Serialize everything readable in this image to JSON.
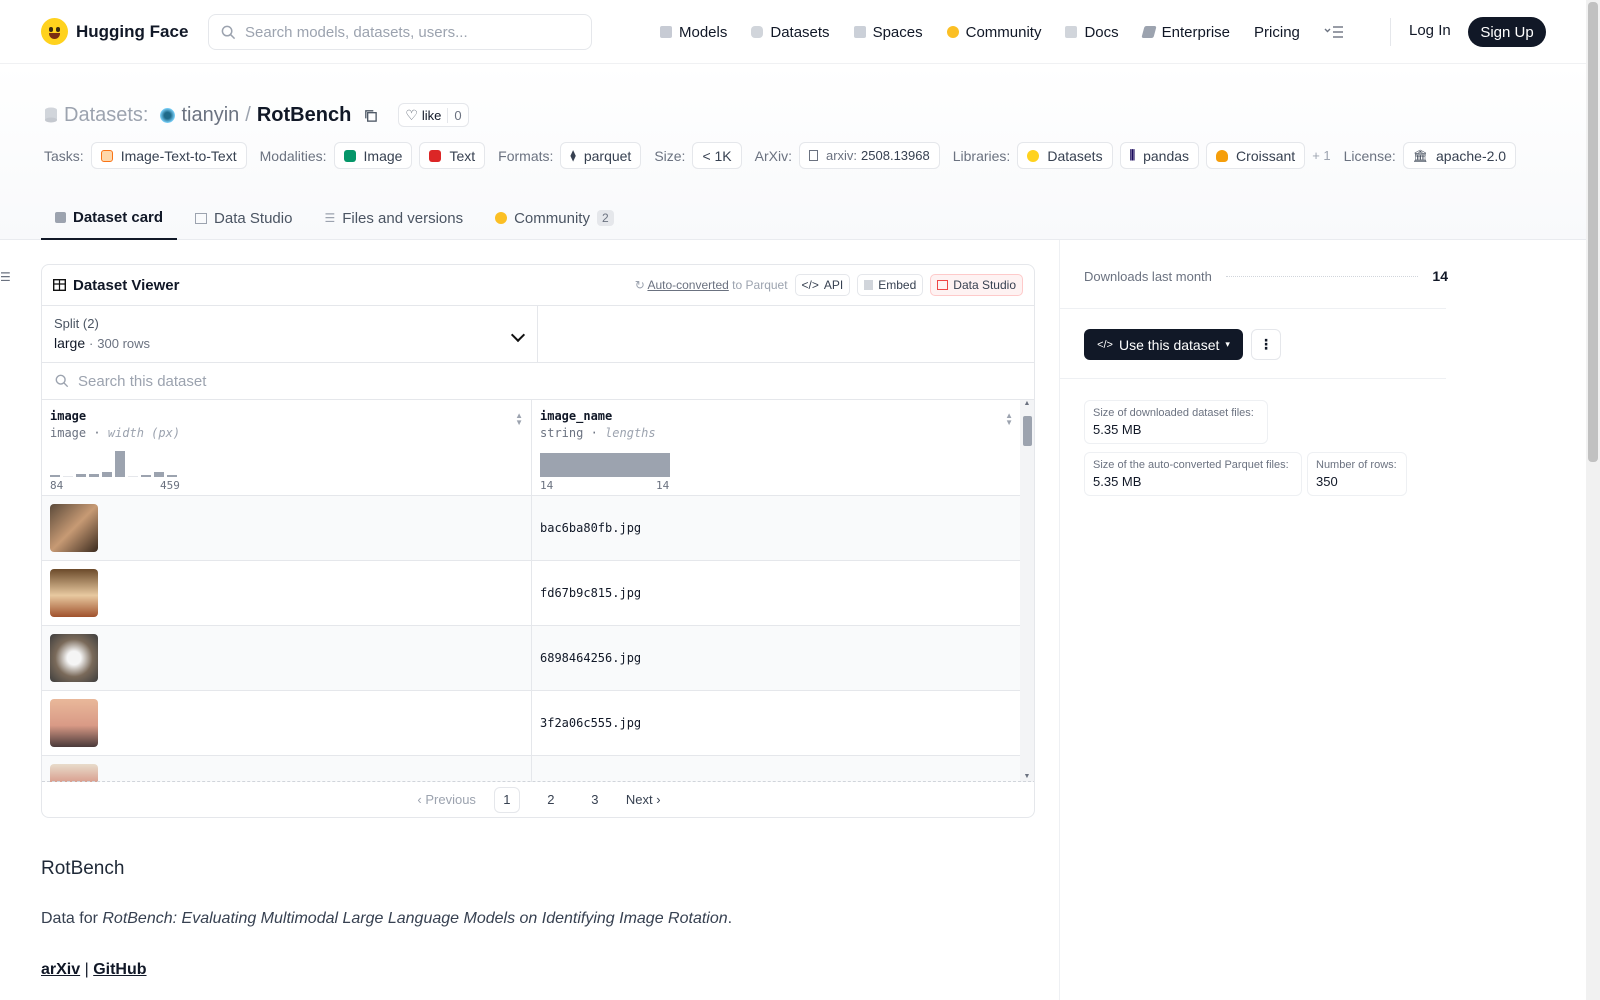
{
  "nav": {
    "brand": "Hugging Face",
    "search_placeholder": "Search models, datasets, users...",
    "links": [
      "Models",
      "Datasets",
      "Spaces",
      "Community",
      "Docs",
      "Enterprise",
      "Pricing"
    ],
    "login": "Log In",
    "signup": "Sign Up"
  },
  "header": {
    "section": "Datasets:",
    "owner": "tianyin",
    "slash": "/",
    "repo": "RotBench",
    "like_label": "like",
    "like_count": "0"
  },
  "tags": {
    "tasks_label": "Tasks:",
    "task": "Image-Text-to-Text",
    "modalities_label": "Modalities:",
    "modalities": [
      "Image",
      "Text"
    ],
    "formats_label": "Formats:",
    "format": "parquet",
    "size_label": "Size:",
    "size": "< 1K",
    "arxiv_label": "ArXiv:",
    "arxiv_prefix": "arxiv:",
    "arxiv_id": "2508.13968",
    "libraries_label": "Libraries:",
    "libraries": [
      "Datasets",
      "pandas",
      "Croissant"
    ],
    "libraries_more": "+ 1",
    "license_label": "License:",
    "license": "apache-2.0"
  },
  "tabs": [
    {
      "label": "Dataset card"
    },
    {
      "label": "Data Studio"
    },
    {
      "label": "Files and versions"
    },
    {
      "label": "Community",
      "badge": "2"
    }
  ],
  "viewer": {
    "title": "Dataset Viewer",
    "auto_converted": "Auto-converted",
    "to_parquet": "to Parquet",
    "api": "API",
    "embed": "Embed",
    "data_studio": "Data Studio",
    "split_label": "Split (2)",
    "split_value": "large",
    "split_rows": "300 rows",
    "search_placeholder": "Search this dataset",
    "columns": [
      {
        "name": "image",
        "type": "image",
        "stat": "width (px)",
        "min": "84",
        "max": "459"
      },
      {
        "name": "image_name",
        "type": "string",
        "stat": "lengths",
        "min": "14",
        "max": "14"
      }
    ],
    "histogram_image": [
      0.05,
      0,
      0.12,
      0.1,
      0.18,
      1.0,
      0,
      0.08,
      0.18,
      0.08
    ],
    "rows": [
      {
        "image_name": "bac6ba80fb.jpg"
      },
      {
        "image_name": "fd67b9c815.jpg"
      },
      {
        "image_name": "6898464256.jpg"
      },
      {
        "image_name": "3f2a06c555.jpg"
      }
    ],
    "pager": {
      "prev": "Previous",
      "pages": [
        "1",
        "2",
        "3"
      ],
      "current": "1",
      "next": "Next"
    }
  },
  "sidebar": {
    "downloads_label": "Downloads last month",
    "downloads": "14",
    "use_button": "Use this dataset",
    "stats": [
      {
        "label": "Size of downloaded dataset files:",
        "value": "5.35 MB"
      },
      {
        "label": "Size of the auto-converted Parquet files:",
        "value": "5.35 MB"
      },
      {
        "label": "Number of rows:",
        "value": "350"
      }
    ]
  },
  "readme": {
    "heading": "RotBench",
    "intro_prefix": "Data for ",
    "intro_title": "RotBench: Evaluating Multimodal Large Language Models on Identifying Image Rotation",
    "intro_suffix": ".",
    "link_arxiv": "arXiv",
    "link_sep": "|",
    "link_github": "GitHub"
  },
  "colors": {
    "accent_dark": "#111827",
    "brand_yellow": "#ffd21e",
    "studio_red": "#ef4444"
  }
}
